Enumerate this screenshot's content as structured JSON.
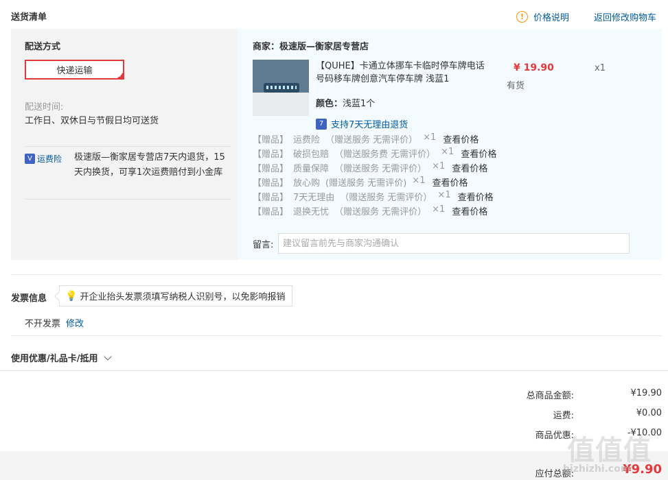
{
  "header": {
    "title": "送货清单",
    "price_note": "价格说明",
    "back_to_cart": "返回修改购物车",
    "info_icon": "!"
  },
  "shipping": {
    "title": "配送方式",
    "method": "快递运输",
    "check_glyph": "✓",
    "time_label": "配送时间:",
    "time_value": "工作日、双休日与节假日均可送货",
    "insurance_icon_glyph": "V",
    "insurance_label": "运费险",
    "insurance_text": "极速版—衡家居专营店7天内退货，15天内换货，可享1次运费赔付到小金库"
  },
  "order": {
    "merchant": "商家：极速版—衡家居专营店",
    "product_name": "【QUHE】卡通立体挪车卡临时停车牌电话号码移车牌创意汽车停车牌 浅蓝1",
    "price": "¥ 19.90",
    "quantity": "x1",
    "stock": "有货",
    "color_key": "颜色：",
    "color_value": "浅蓝1个",
    "return_icon_glyph": "7",
    "return_policy": "支持7天无理由退货",
    "gifts": [
      {
        "tag": "【赠品】",
        "name": "运费险",
        "note": "（赠送服务 无需评价）",
        "qty": "×1",
        "link": "查看价格"
      },
      {
        "tag": "【赠品】",
        "name": "破损包赔",
        "note": "（赠送服务费 无需评价）",
        "qty": "×1",
        "link": "查看价格"
      },
      {
        "tag": "【赠品】",
        "name": "质量保障",
        "note": "（赠送服务 无需评价）",
        "qty": "×1",
        "link": "查看价格"
      },
      {
        "tag": "【赠品】",
        "name": "放心购",
        "note": "(赠送服务 无需评价)",
        "qty": "×1",
        "link": "查看价格"
      },
      {
        "tag": "【赠品】",
        "name": "7天无理由",
        "note": "（赠送服务 无需评价）",
        "qty": "×1",
        "link": "查看价格"
      },
      {
        "tag": "【赠品】",
        "name": "退换无忧",
        "note": "（赠送服务 无需评价）",
        "qty": "×1",
        "link": "查看价格"
      }
    ],
    "message_label": "留言:",
    "message_placeholder": "建议留言前先与商家沟通确认"
  },
  "invoice": {
    "title": "发票信息",
    "tip": "开企业抬头发票须填写纳税人识别号，以免影响报销",
    "value": "不开发票",
    "edit": "修改"
  },
  "discount": {
    "title": "使用优惠/礼品卡/抵用"
  },
  "summary": {
    "rows": [
      {
        "label": "总商品金额:",
        "value": "¥19.90"
      },
      {
        "label": "运费:",
        "value": "¥0.00"
      },
      {
        "label": "商品优惠:",
        "value": "-¥10.00"
      }
    ],
    "payable_label": "应付总额:",
    "payable_value": "¥9.90"
  },
  "watermark": {
    "logo": "值值值",
    "text": "hizhizhi.com"
  },
  "colors": {
    "accent_red": "#e4393c",
    "link_blue": "#005aa0",
    "panel_left": "#f3f3f3",
    "panel_right": "#f3fbfe"
  }
}
